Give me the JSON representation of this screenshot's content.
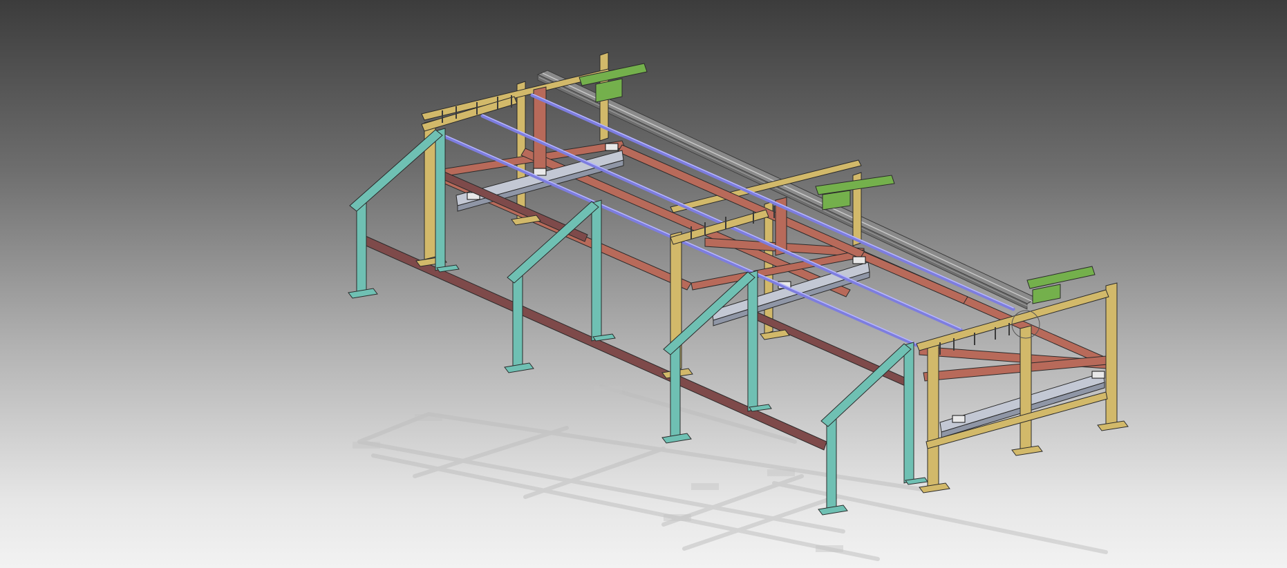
{
  "viewport": {
    "background_top": "#3c3c3c",
    "background_bottom": "#f2f2f2"
  },
  "colors": {
    "teal_frame": "#6fc0b3",
    "yellow_frame": "#d2b96a",
    "red_beam": "#b86a5a",
    "maroon_beam": "#7e4a4a",
    "blue_rod": "#7d7ddf",
    "green_bracket": "#74b04c",
    "grey_cable": "#8a8a8a",
    "silver_channel": "#c3c8d4",
    "shadow": "#c8c8c8",
    "outline": "#2a2a2a"
  },
  "model": {
    "name": "steel-frame-assembly",
    "view": "isometric",
    "visible_text": ""
  }
}
